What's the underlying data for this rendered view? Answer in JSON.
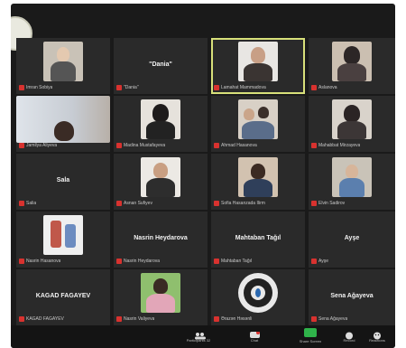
{
  "participants": [
    {
      "name": "Imran Sobiya",
      "center": "",
      "photo": "person-gray"
    },
    {
      "name": "\"Dania\"",
      "center": "\"Dania\"",
      "photo": ""
    },
    {
      "name": "Lamahat Mammadova",
      "center": "",
      "photo": "person-dark"
    },
    {
      "name": "Aslanova",
      "center": "",
      "photo": "person-hijab"
    },
    {
      "name": "Jamilya Aliyeva",
      "center": "",
      "photo": "person-window"
    },
    {
      "name": "Madina Mustafayeva",
      "center": "",
      "photo": "person-dark"
    },
    {
      "name": "Ahmad Hasanova",
      "center": "",
      "photo": "person-family"
    },
    {
      "name": "Mahabbat Mirzayeva",
      "center": "",
      "photo": "person-hijab"
    },
    {
      "name": "Salia",
      "center": "Sala",
      "photo": ""
    },
    {
      "name": "Asnan Sufiyev",
      "center": "",
      "photo": "person-boy"
    },
    {
      "name": "Sofia Hasanzada Ilirm",
      "center": "",
      "photo": "person-girl"
    },
    {
      "name": "Elvin Sadirov",
      "center": "",
      "photo": "person-kid"
    },
    {
      "name": "Nasrin Hasanova",
      "center": "",
      "photo": "person-drawing"
    },
    {
      "name": "Nasrin Heydarova",
      "center": "Nasrin Heydarova",
      "photo": ""
    },
    {
      "name": "Mahtaban Tağıl",
      "center": "Mahtaban Tağıl",
      "photo": ""
    },
    {
      "name": "Ayşe",
      "center": "Ayşe",
      "photo": ""
    },
    {
      "name": "KAGAD FAGAYEV",
      "center": "KAGAD FAGAYEV",
      "photo": ""
    },
    {
      "name": "Nasrin Valiyeva",
      "center": "",
      "photo": "person-green"
    },
    {
      "name": "Ərazən Həsənli",
      "center": "",
      "photo": "emblem"
    },
    {
      "name": "Sena Ağayeva",
      "center": "Sena Ağayeva",
      "photo": ""
    }
  ],
  "toolbar": {
    "participants_label": "Participants",
    "participants_count": "32",
    "chat_label": "Chat",
    "share_label": "Share Screen",
    "record_label": "Record",
    "reactions_label": "Reactions"
  },
  "colors": {
    "active_border": "#d8e07a",
    "mic_muted": "#d8322f",
    "share": "#2fb34a"
  }
}
